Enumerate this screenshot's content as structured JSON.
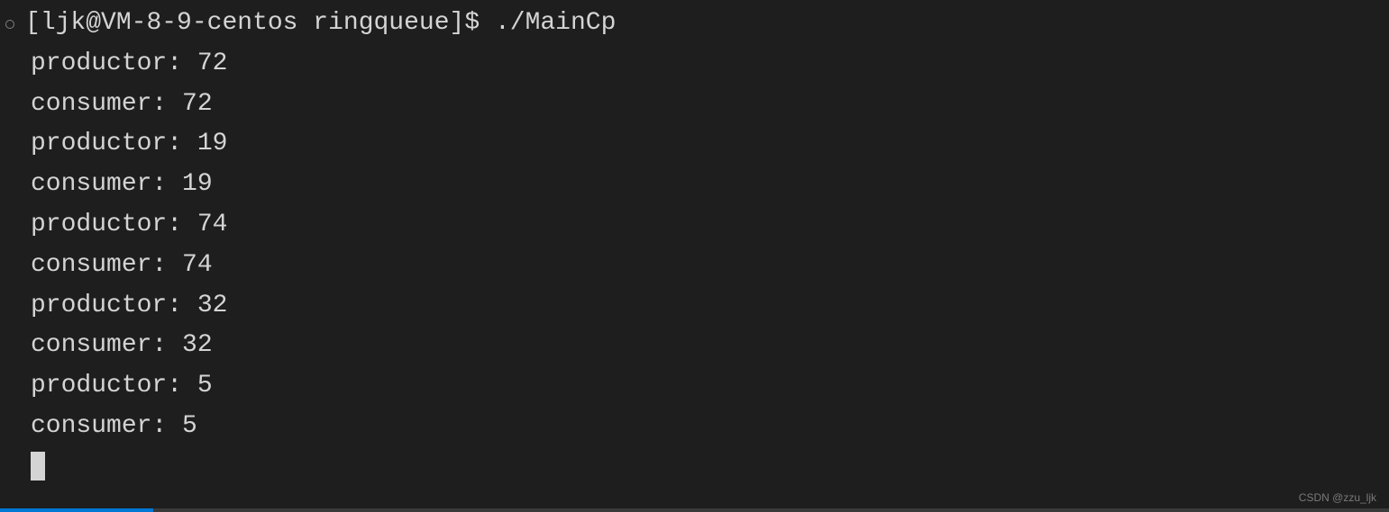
{
  "prompt": {
    "user": "ljk",
    "host": "VM-8-9-centos",
    "dir": "ringqueue",
    "symbol": "$",
    "command": "./MainCp"
  },
  "output": [
    "productor: 72",
    "consumer: 72",
    "productor: 19",
    "consumer: 19",
    "productor: 74",
    "consumer: 74",
    "productor: 32",
    "consumer: 32",
    "productor: 5",
    "consumer: 5"
  ],
  "watermark": "CSDN @zzu_ljk"
}
